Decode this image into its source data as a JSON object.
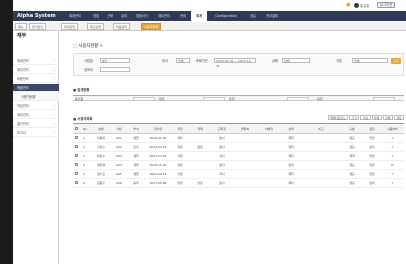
{
  "util": {
    "user": "홍길동",
    "logout": "로그아웃"
  },
  "nav": {
    "logo": "Alpha System",
    "menu": [
      "회계관리",
      "영업",
      "근태",
      "급여",
      "법정서식",
      "재무관리",
      "관리",
      "회계",
      "Configuration",
      "공유",
      "전자결재"
    ],
    "active_index": 7
  },
  "tabs": [
    "메뉴",
    "즐겨찾기",
    "회계관리",
    "매출관리",
    "비용관리",
    "사용자현황"
  ],
  "sidebar": {
    "title": "재무",
    "items": [
      {
        "label": "회계관리",
        "type": "item"
      },
      {
        "label": "재무관리",
        "type": "item"
      },
      {
        "label": "비용관리",
        "type": "item"
      },
      {
        "label": "매출관리",
        "type": "active"
      },
      {
        "label": "사용자현황",
        "type": "sub"
      },
      {
        "label": "자금관리",
        "type": "item"
      },
      {
        "label": "세무관리",
        "type": "item"
      },
      {
        "label": "결산관리",
        "type": "item"
      },
      {
        "label": "보고서",
        "type": "item"
      }
    ]
  },
  "page": {
    "title": "사용자현황"
  },
  "search": {
    "row1": [
      {
        "label": "사업장",
        "value": "본사"
      },
      {
        "label": "부서",
        "value": "전체"
      },
      {
        "label": "조회기간",
        "value": "2023-01-01 ~ 2023-12-31"
      },
      {
        "label": "상태",
        "value": "전체"
      },
      {
        "label": "구분",
        "value": "전체"
      }
    ],
    "row2": [
      {
        "label": "검색어",
        "value": ""
      }
    ],
    "search_button": "조회"
  },
  "summary": {
    "title": "집계현황",
    "items": [
      "총인원",
      "재직",
      "휴직",
      "퇴직"
    ]
  },
  "grid": {
    "title": "사용자목록",
    "buttons": [
      "엑셀다운로드",
      "추가",
      "저장",
      "삭제",
      "인쇄",
      "설정"
    ],
    "columns": [
      "",
      "No",
      "성명",
      "사번",
      "부서",
      "입사일",
      "직급",
      "직책",
      "근무지",
      "연락처",
      "이메일",
      "상태",
      "비고",
      "구분",
      "권한",
      "사용여부"
    ],
    "rows": [
      [
        "1",
        "이영희",
        "A01",
        "영업",
        "2020-01-02",
        "대리",
        "",
        "본사",
        "",
        "",
        "재직",
        "",
        "정규",
        "일반",
        "Y"
      ],
      [
        "2",
        "김철수",
        "A02",
        "인사",
        "2019-03-15",
        "과장",
        "팀장",
        "본사",
        "",
        "",
        "재직",
        "",
        "정규",
        "관리",
        "Y"
      ],
      [
        "3",
        "박민수",
        "A03",
        "재무",
        "2021-07-01",
        "사원",
        "",
        "지사",
        "",
        "",
        "재직",
        "",
        "계약",
        "일반",
        "Y"
      ],
      [
        "4",
        "최지영",
        "A04",
        "개발",
        "2018-11-20",
        "차장",
        "",
        "본사",
        "",
        "",
        "휴직",
        "",
        "정규",
        "일반",
        "N"
      ],
      [
        "5",
        "정수진",
        "A05",
        "영업",
        "2022-02-14",
        "사원",
        "",
        "지사",
        "",
        "",
        "재직",
        "",
        "정규",
        "일반",
        "Y"
      ],
      [
        "6",
        "한동훈",
        "A06",
        "총무",
        "2017-05-08",
        "부장",
        "실장",
        "본사",
        "",
        "",
        "재직",
        "",
        "정규",
        "관리",
        "Y"
      ]
    ]
  }
}
